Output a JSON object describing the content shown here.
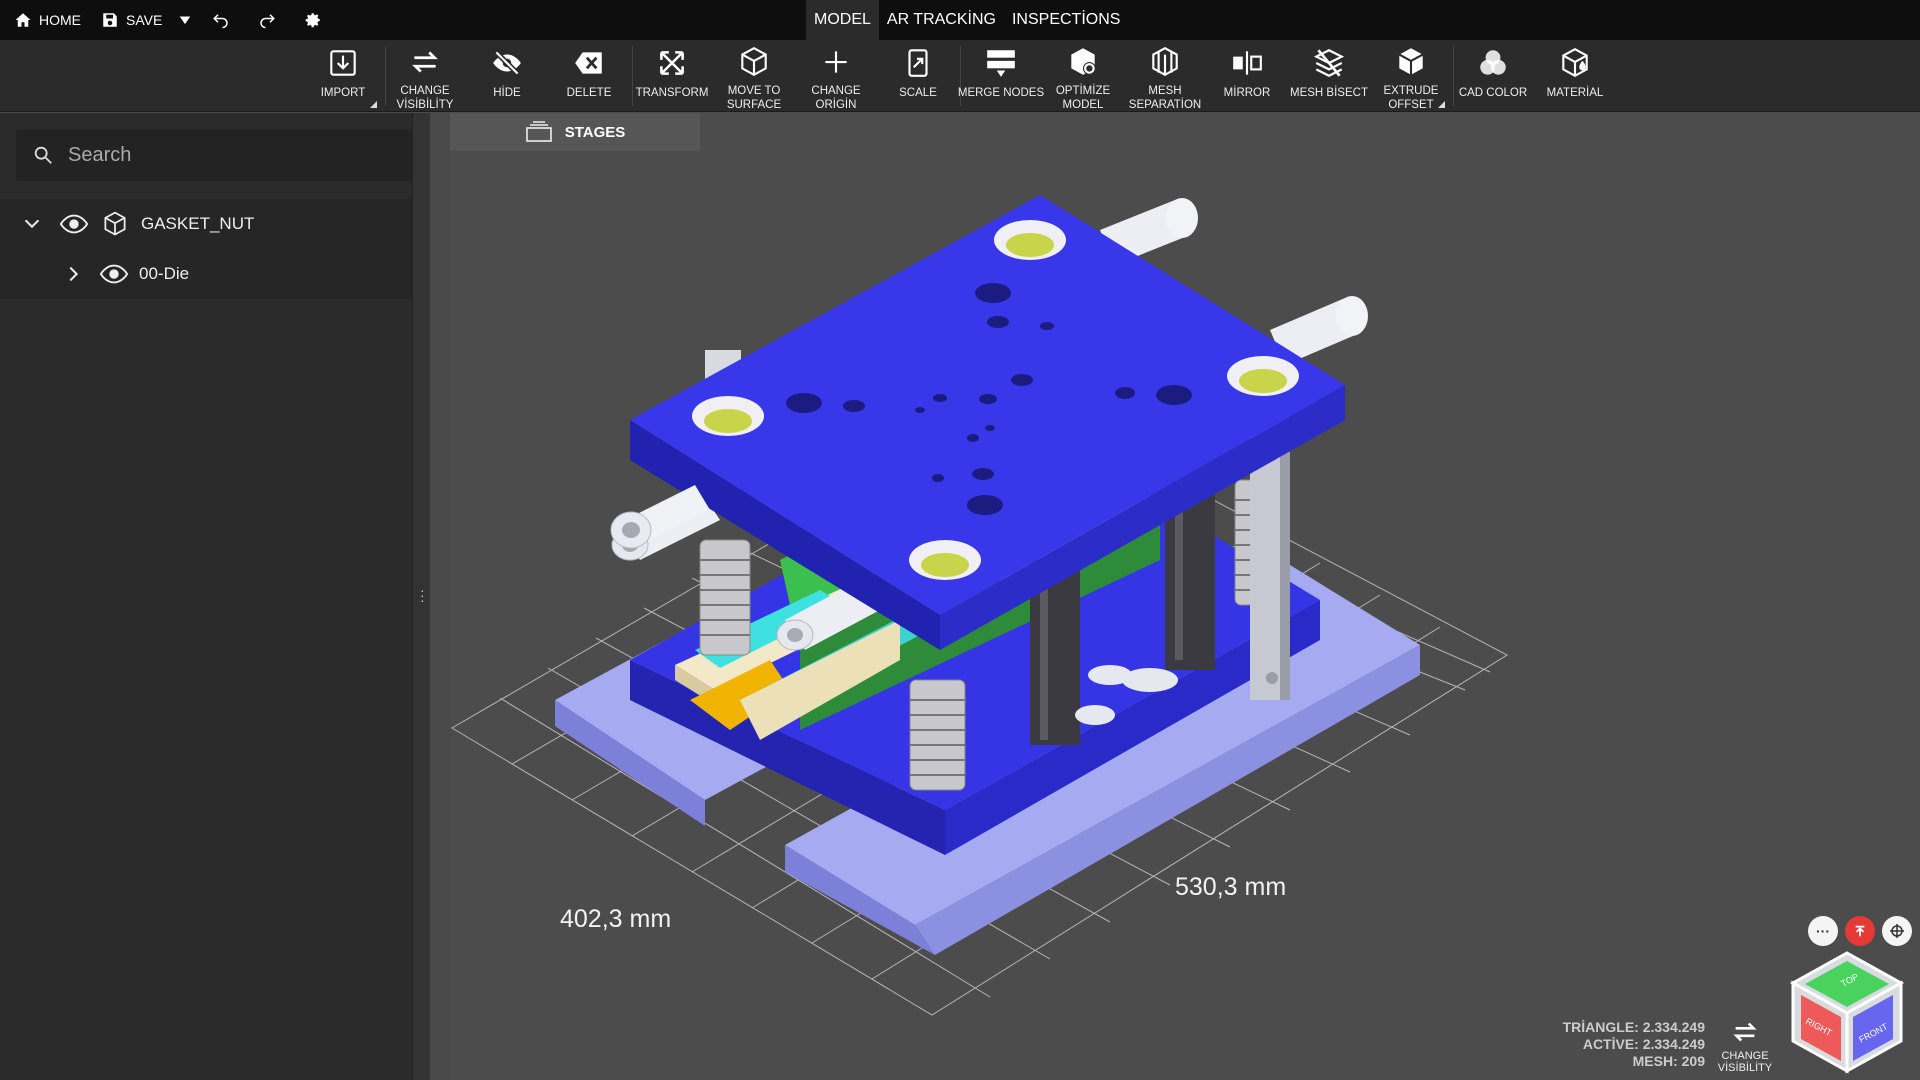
{
  "topbar": {
    "home": "HOME",
    "save": "SAVE",
    "tabs": [
      "MODEL",
      "AR TRACKİNG",
      "INSPECTİONS"
    ]
  },
  "ribbon": [
    {
      "label": "IMPORT",
      "icon": "import-icon"
    },
    {
      "label": "CHANGE VİSİBİLİTY",
      "icon": "swap-icon"
    },
    {
      "label": "HİDE",
      "icon": "hide-eye-icon"
    },
    {
      "label": "DELETE",
      "icon": "delete-icon"
    },
    {
      "label": "TRANSFORM",
      "icon": "transform-icon"
    },
    {
      "label": "MOVE TO SURFACE",
      "icon": "move-surface-icon"
    },
    {
      "label": "CHANGE ORİGİN",
      "icon": "plus-origin-icon"
    },
    {
      "label": "SCALE",
      "icon": "scale-icon"
    },
    {
      "label": "MERGE NODES",
      "icon": "merge-icon"
    },
    {
      "label": "OPTİMİZE MODEL",
      "icon": "optimize-icon"
    },
    {
      "label": "MESH SEPARATİON",
      "icon": "mesh-separation-icon"
    },
    {
      "label": "MİRROR",
      "icon": "mirror-icon"
    },
    {
      "label": "MESH BİSECT",
      "icon": "mesh-bisect-icon"
    },
    {
      "label": "EXTRUDE OFFSET",
      "icon": "extrude-icon"
    },
    {
      "label": "CAD COLOR",
      "icon": "cad-color-icon"
    },
    {
      "label": "MATERİAL",
      "icon": "material-icon"
    }
  ],
  "sidebar": {
    "search_placeholder": "Search",
    "tree": [
      {
        "label": "GASKET_NUT",
        "expanded": true
      },
      {
        "label": "00-Die",
        "expanded": false
      }
    ]
  },
  "viewport": {
    "stages": "STAGES",
    "dim_x": "402,3 mm",
    "dim_y": "530,3 mm",
    "stats": {
      "triangle": "TRİANGLE: 2.334.249",
      "active": "ACTİVE: 2.334.249",
      "mesh": "MESH: 209"
    },
    "change_visibility": "CHANGE VİSİBİLİTY",
    "cube": {
      "top": "TOP",
      "right": "RIGHT",
      "front": "FRONT"
    }
  },
  "colors": {
    "plate": "#3535e6",
    "plate_dark": "#2020a8",
    "base": "#9aa0ec",
    "accent_red": "#e53935"
  }
}
